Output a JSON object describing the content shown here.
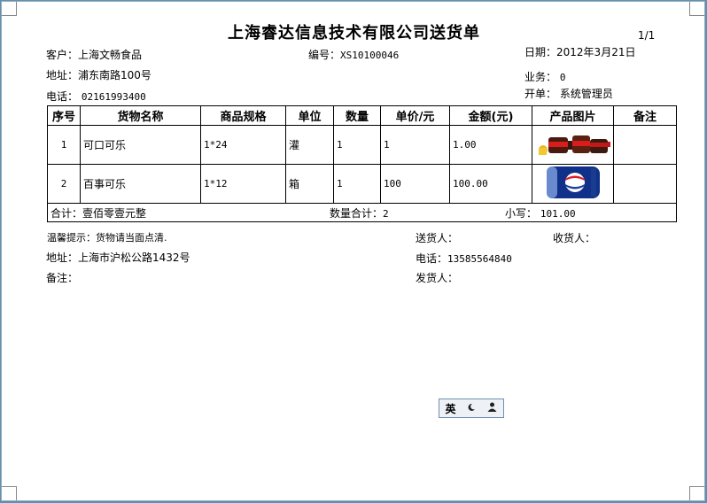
{
  "page_no": "1/1",
  "title": "上海睿达信息技术有限公司送货单",
  "header": {
    "customer": "客户：上海文畅食品",
    "order_no_label": "编号：",
    "order_no": "XS10100046",
    "date_label": "日期：",
    "date": "2012年3月21日",
    "address": "地址：浦东南路100号",
    "business_label": "业务：",
    "business": "0",
    "phone_label": "电话：",
    "phone": "02161993400",
    "maker_label": "开单：",
    "maker": "系统管理员"
  },
  "table": {
    "headers": [
      "序号",
      "货物名称",
      "商品规格",
      "单位",
      "数量",
      "单价/元",
      "金额(元)",
      "产品图片",
      "备注"
    ],
    "rows": [
      {
        "no": "1",
        "name": "可口可乐",
        "spec": "1*24",
        "unit": "灌",
        "qty": "1",
        "price": "1",
        "amount": "1.00",
        "image": "cola-bottles-image",
        "note": ""
      },
      {
        "no": "2",
        "name": "百事可乐",
        "spec": "1*12",
        "unit": "箱",
        "qty": "1",
        "price": "100",
        "amount": "100.00",
        "image": "pepsi-can-image",
        "note": ""
      }
    ],
    "total_words": "合计：壹佰零壹元整",
    "qty_total_label": "数量合计：",
    "qty_total": "2",
    "small_label": "小写：",
    "small_value": "101.00"
  },
  "footer": {
    "tip": "温馨提示：货物请当面点清.",
    "sender_label": "送货人：",
    "receiver_label": "收货人：",
    "address": "地址：上海市沪松公路1432号",
    "phone_label": "电话：",
    "phone": "13585564840",
    "remark_label": "备注：",
    "shipper_label": "发货人："
  },
  "ime": {
    "lang": "英",
    "mode_icon": "moon-icon",
    "user_icon": "user-icon"
  }
}
